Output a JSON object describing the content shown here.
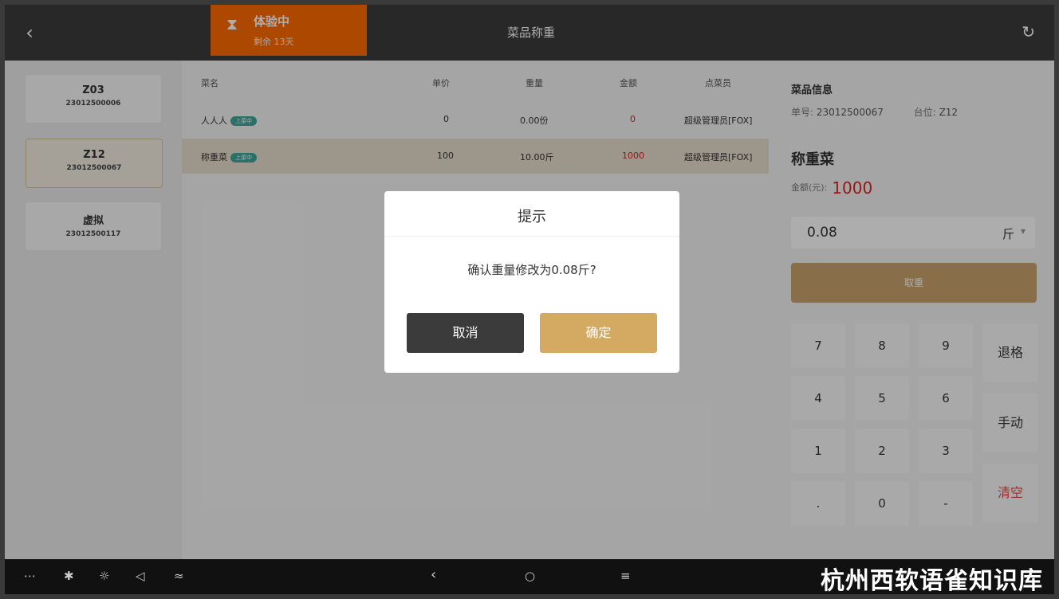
{
  "header": {
    "back_icon": "chevron-left-icon",
    "trial_title": "体验中",
    "trial_remaining": "剩余 13天",
    "page_title": "菜品称重",
    "refresh_icon": "refresh-icon"
  },
  "tables": [
    {
      "code": "Z03",
      "order_no": "23012500006",
      "active": false
    },
    {
      "code": "Z12",
      "order_no": "23012500067",
      "active": true
    },
    {
      "code": "虚拟",
      "order_no": "23012500117",
      "active": false
    }
  ],
  "dish_table": {
    "headers": [
      "菜名",
      "单价",
      "重量",
      "金额",
      "点菜员"
    ],
    "rows": [
      {
        "name": "人人人",
        "badge": "上菜中",
        "price": "0",
        "weight": "0.00份",
        "amount": "0",
        "waiter": "超级管理员[FOX]",
        "selected": false
      },
      {
        "name": "称重菜",
        "badge": "上菜中",
        "price": "100",
        "weight": "10.00斤",
        "amount": "1000",
        "waiter": "超级管理员[FOX]",
        "selected": true
      }
    ]
  },
  "dish_info": {
    "title": "菜品信息",
    "order_label": "单号:",
    "order_no": "23012500067",
    "table_label": "台位:",
    "table_no": "Z12",
    "dish_name": "称重菜",
    "amount_label": "金额(元):",
    "amount": "1000",
    "weight_value": "0.08",
    "weight_unit": "斤",
    "tare_label": "取重"
  },
  "keypad": {
    "keys": [
      "7",
      "8",
      "9",
      "4",
      "5",
      "6",
      "1",
      "2",
      "3",
      ".",
      "0",
      "-"
    ],
    "backspace": "退格",
    "manual": "手动",
    "clear": "清空"
  },
  "dialog": {
    "title": "提示",
    "message": "确认重量修改为0.08斤?",
    "cancel": "取消",
    "confirm": "确定"
  },
  "navbar": {
    "watermark": "杭州西软语雀知识库"
  },
  "colors": {
    "accent_gold": "#c9a46c",
    "trial_orange": "#ff6a00",
    "topbar": "#3b3b3b",
    "amount_red": "#e02020"
  }
}
